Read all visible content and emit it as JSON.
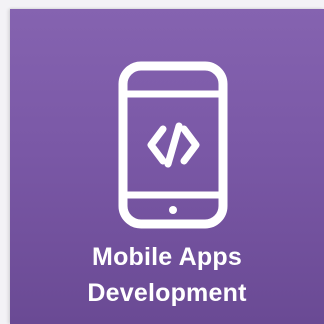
{
  "tile": {
    "icon": "mobile-code-icon",
    "label_line1": "Mobile Apps",
    "label_line2": "Development",
    "background_color": "#7a58a6",
    "foreground_color": "#ffffff"
  }
}
